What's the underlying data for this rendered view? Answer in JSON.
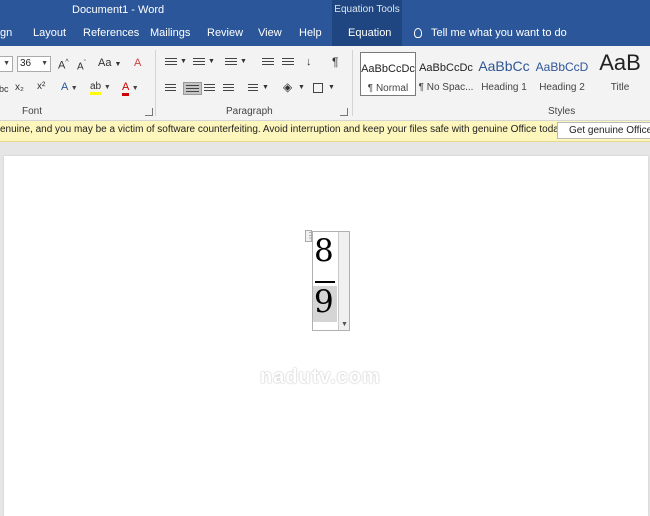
{
  "titlebar": {
    "title": "Document1  -  Word",
    "context_tab_group": "Equation Tools",
    "tabs": [
      {
        "label": "gn"
      },
      {
        "label": "Layout"
      },
      {
        "label": "References"
      },
      {
        "label": "Mailings"
      },
      {
        "label": "Review"
      },
      {
        "label": "View"
      },
      {
        "label": "Help"
      },
      {
        "label": "Equation"
      }
    ],
    "tell_me": "Tell me what you want to do"
  },
  "ribbon": {
    "font": {
      "group_label": "Font",
      "font_name_value": "",
      "font_size_value": "36",
      "grow_label": "A",
      "shrink_label": "A",
      "change_case_label": "Aa",
      "clear_format_label": "A",
      "abc_label": "abc",
      "superscript_label": "x²",
      "text_effects_label": "A",
      "highlight_label": "ab",
      "font_color_label": "A"
    },
    "paragraph": {
      "group_label": "Paragraph",
      "show_marks_label": "¶",
      "sort_label": "↓"
    },
    "styles": {
      "group_label": "Styles",
      "items": [
        {
          "sample": "AaBbCcDc",
          "name": "¶ Normal"
        },
        {
          "sample": "AaBbCcDc",
          "name": "¶ No Spac..."
        },
        {
          "sample": "AaBbCc",
          "name": "Heading 1"
        },
        {
          "sample": "AaBbCcD",
          "name": "Heading 2"
        },
        {
          "sample": "AaB",
          "name": "Title"
        }
      ]
    }
  },
  "message_bar": {
    "text": "enuine, and you may be a victim of software counterfeiting. Avoid interruption and keep your files safe with genuine Office today.",
    "button_label": "Get genuine Office"
  },
  "document": {
    "equation": {
      "numerator": "8",
      "denominator": "9"
    },
    "watermark": "nadutv.com"
  },
  "colors": {
    "title_bar": "#2b579a",
    "context_tab": "#1f4680",
    "message_bar": "#fdf6bd",
    "font_color_swatch": "#cc0000",
    "highlight_swatch": "#ffff00"
  }
}
